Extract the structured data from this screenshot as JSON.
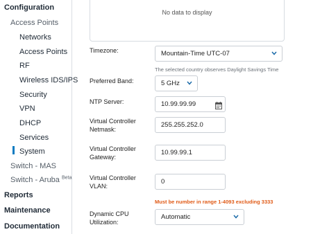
{
  "sidebar": {
    "configuration": "Configuration",
    "access_points": "Access Points",
    "items": [
      {
        "label": "Networks"
      },
      {
        "label": "Access Points"
      },
      {
        "label": "RF"
      },
      {
        "label": "Wireless IDS/IPS"
      },
      {
        "label": "Security"
      },
      {
        "label": "VPN"
      },
      {
        "label": "DHCP"
      },
      {
        "label": "Services"
      },
      {
        "label": "System"
      }
    ],
    "active_item": "System",
    "switch_mas": "Switch - MAS",
    "switch_aruba": "Switch - Aruba",
    "switch_aruba_badge": "Beta",
    "reports": "Reports",
    "maintenance": "Maintenance",
    "documentation": "Documentation"
  },
  "main": {
    "empty_state": "No data to display",
    "timezone": {
      "label": "Timezone:",
      "value": "Mountain-Time UTC-07",
      "note": "The selected country observes Daylight Savings Time"
    },
    "preferred_band": {
      "label": "Preferred Band:",
      "value": "5 GHz"
    },
    "ntp_server": {
      "label": "NTP Server:",
      "value": "10.99.99.99"
    },
    "vc_netmask": {
      "label_line1": "Virtual Controller",
      "label_line2": "Netmask:",
      "value": "255.255.252.0"
    },
    "vc_gateway": {
      "label_line1": "Virtual Controller",
      "label_line2": "Gateway:",
      "value": "10.99.99.1"
    },
    "vc_vlan": {
      "label_line1": "Virtual Controller",
      "label_line2": "VLAN:",
      "value": "0",
      "error": "Must be number in range 1-4093 excluding 3333"
    },
    "dynamic_cpu": {
      "label_line1": "Dynamic CPU",
      "label_line2": "Utilization:",
      "value": "Automatic"
    }
  },
  "colors": {
    "accent": "#0a7bc1",
    "error": "#e05a16",
    "border": "#c9ced4",
    "chevron": "#1a6aa8"
  },
  "icons": {
    "select_chevron": "chevron-down-icon",
    "ntp_picker": "calendar-icon"
  }
}
